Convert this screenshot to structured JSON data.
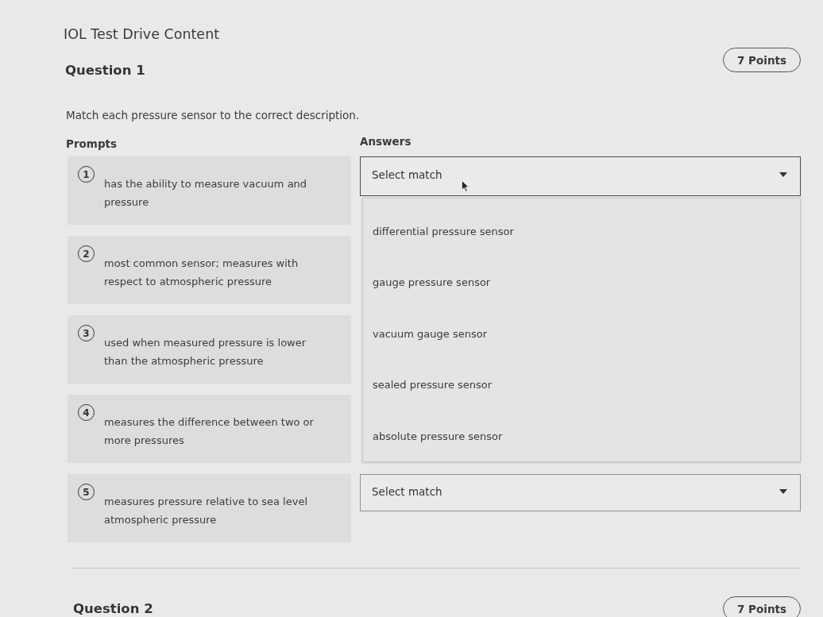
{
  "page": {
    "title": "IOL Test Drive Content"
  },
  "questions": [
    {
      "title": "Question 1",
      "points": "7 Points",
      "instruction": "Match each pressure sensor to the correct description.",
      "prompts_heading": "Prompts",
      "answers_heading": "Answers",
      "prompts": [
        {
          "number": "1",
          "text": "has the ability to measure vacuum and pressure",
          "answer": {
            "value": "Select match",
            "expanded": true,
            "options": [
              "differential pressure sensor",
              "gauge pressure sensor",
              "vacuum gauge sensor",
              "sealed pressure sensor",
              "absolute pressure sensor"
            ]
          }
        },
        {
          "number": "2",
          "text": "most common sensor; measures with respect to atmospheric pressure"
        },
        {
          "number": "3",
          "text": "used when measured pressure is lower than the atmospheric pressure"
        },
        {
          "number": "4",
          "text": "measures the difference between two or more pressures"
        },
        {
          "number": "5",
          "text": "measures pressure relative to sea level atmospheric pressure",
          "answer": {
            "value": "Select match",
            "expanded": false
          }
        }
      ]
    },
    {
      "title": "Question 2",
      "points": "7 Points"
    }
  ]
}
